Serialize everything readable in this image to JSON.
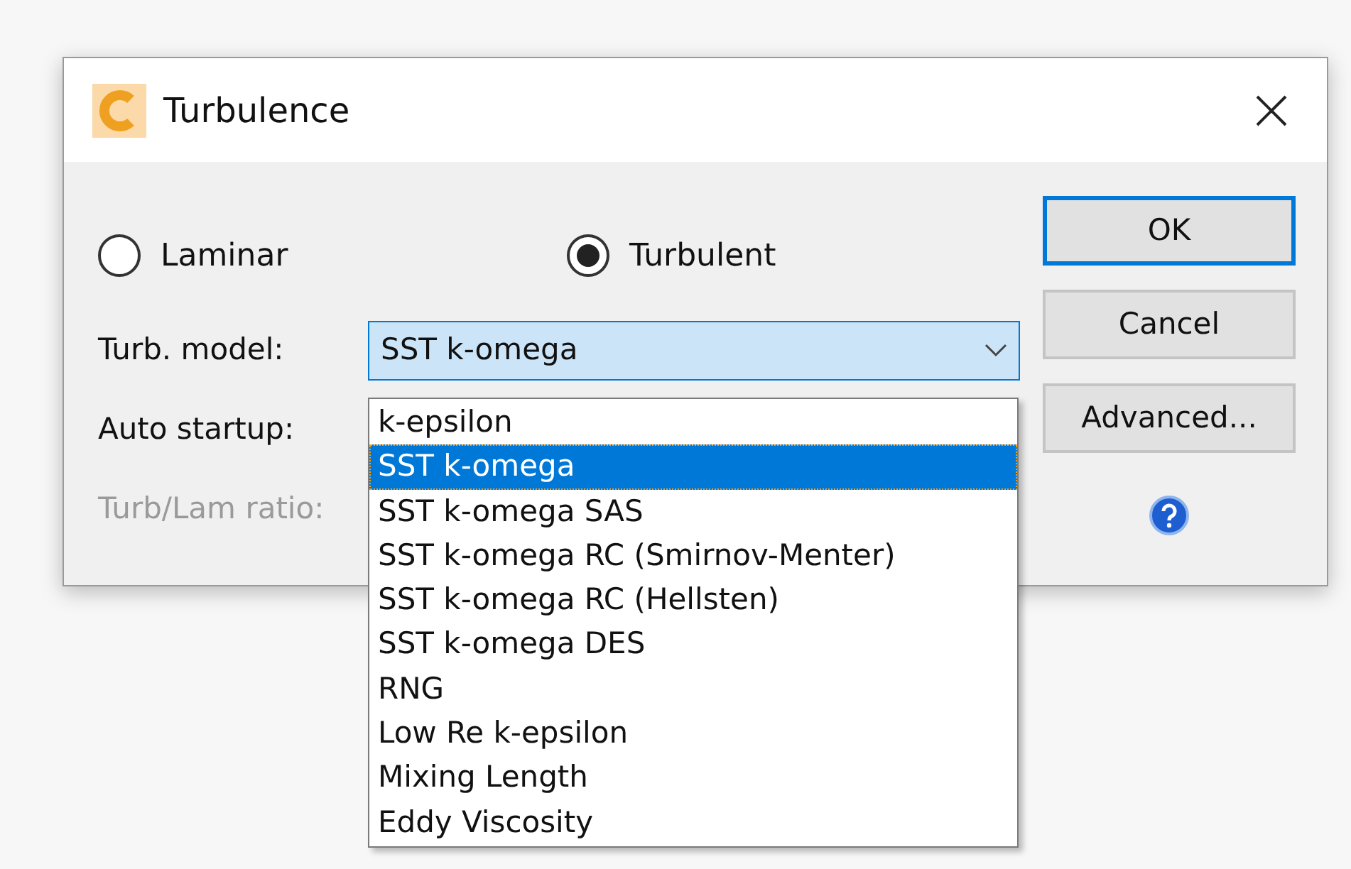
{
  "window": {
    "title": "Turbulence"
  },
  "flow_type": [
    {
      "label": "Laminar",
      "selected": false
    },
    {
      "label": "Turbulent",
      "selected": true
    }
  ],
  "fields": [
    {
      "label": "Turb. model:",
      "disabled": false
    },
    {
      "label": "Auto startup:",
      "disabled": false
    },
    {
      "label": "Turb/Lam ratio:",
      "disabled": true
    }
  ],
  "turb_model": {
    "value": "SST k-omega",
    "expanded": true,
    "options": [
      {
        "label": "k-epsilon",
        "selected": false
      },
      {
        "label": "SST k-omega",
        "selected": true
      },
      {
        "label": "SST k-omega SAS",
        "selected": false
      },
      {
        "label": "SST k-omega RC (Smirnov-Menter)",
        "selected": false
      },
      {
        "label": "SST k-omega RC (Hellsten)",
        "selected": false
      },
      {
        "label": "SST k-omega DES",
        "selected": false
      },
      {
        "label": "RNG",
        "selected": false
      },
      {
        "label": "Low Re k-epsilon",
        "selected": false
      },
      {
        "label": "Mixing Length",
        "selected": false
      },
      {
        "label": "Eddy Viscosity",
        "selected": false
      }
    ]
  },
  "buttons": [
    {
      "label": "OK",
      "default": true
    },
    {
      "label": "Cancel",
      "default": false
    },
    {
      "label": "Advanced...",
      "default": false
    }
  ]
}
